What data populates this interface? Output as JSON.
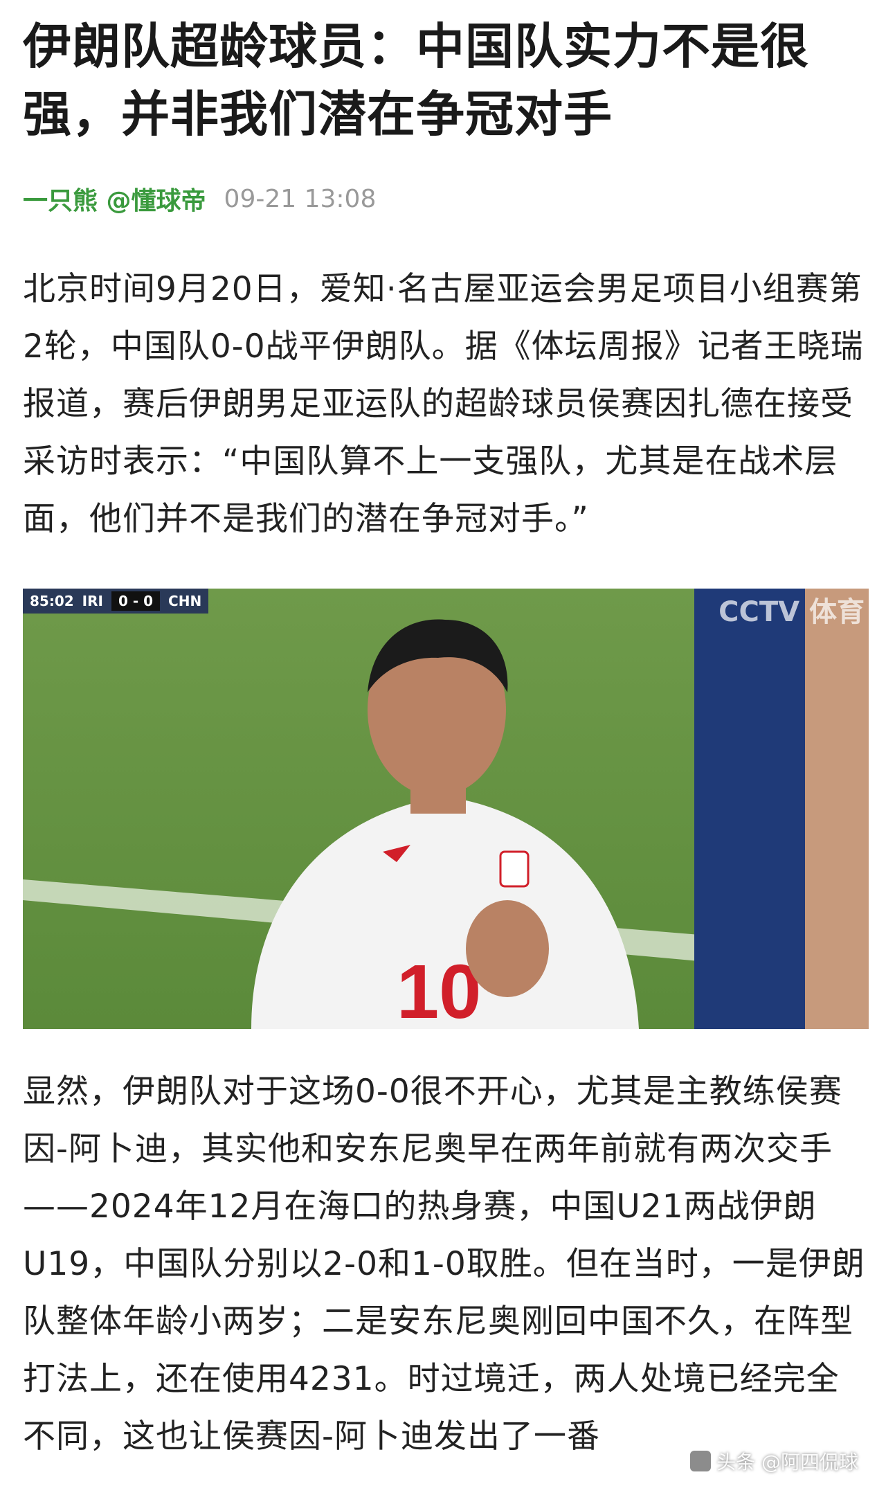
{
  "article": {
    "title": "伊朗队超龄球员：中国队实力不是很强，并非我们潜在争冠对手",
    "author": "一只熊 @懂球帝",
    "time": "09-21 13:08",
    "paragraph1": "北京时间9月20日，爱知·名古屋亚运会男足项目小组赛第2轮，中国队0-0战平伊朗队。据《体坛周报》记者王晓瑞报道，赛后伊朗男足亚运队的超龄球员侯赛因扎德在接受采访时表示：“中国队算不上一支强队，尤其是在战术层面，他们并不是我们的潜在争冠对手。”",
    "paragraph2": "显然，伊朗队对于这场0-0很不开心，尤其是主教练侯赛因-阿卜迪，其实他和安东尼奥早在两年前就有两次交手——2024年12月在海口的热身赛，中国U21两战伊朗U19，中国队分别以2-0和1-0取胜。但在当时，一是伊朗队整体年龄小两岁；二是安东尼奥刚回中国不久，在阵型打法上，还在使用4231。时过境迁，两人处境已经完全不同，这也让侯赛因-阿卜迪发出了一番"
  },
  "photo": {
    "scorebug": {
      "clock": "85:02",
      "home": "IRI",
      "score": "0 - 0",
      "away": "CHN"
    },
    "broadcaster_logo": "CCTV 体育",
    "jersey_number": "10"
  },
  "watermark": {
    "text": "头条 @阿四侃球"
  },
  "colors": {
    "author_green": "#3a9a3d",
    "time_gray": "#999999",
    "pitch_green": "#5f8f3f"
  }
}
